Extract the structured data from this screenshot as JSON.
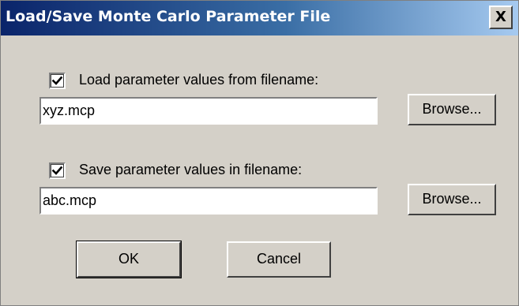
{
  "window": {
    "title": "Load/Save Monte Carlo Parameter File",
    "close_label": "X"
  },
  "load": {
    "checked": true,
    "label": "Load parameter values from filename:",
    "filename": "xyz.mcp",
    "browse_label": "Browse..."
  },
  "save": {
    "checked": true,
    "label": "Save parameter values in filename:",
    "filename": "abc.mcp",
    "browse_label": "Browse..."
  },
  "actions": {
    "ok_label": "OK",
    "cancel_label": "Cancel"
  },
  "icons": {
    "checkbox_mark": "checkmark-icon",
    "close": "close-icon"
  },
  "colors": {
    "dialog_bg": "#d4d0c8",
    "titlebar_start": "#0a246a",
    "titlebar_end": "#a6caf0"
  }
}
